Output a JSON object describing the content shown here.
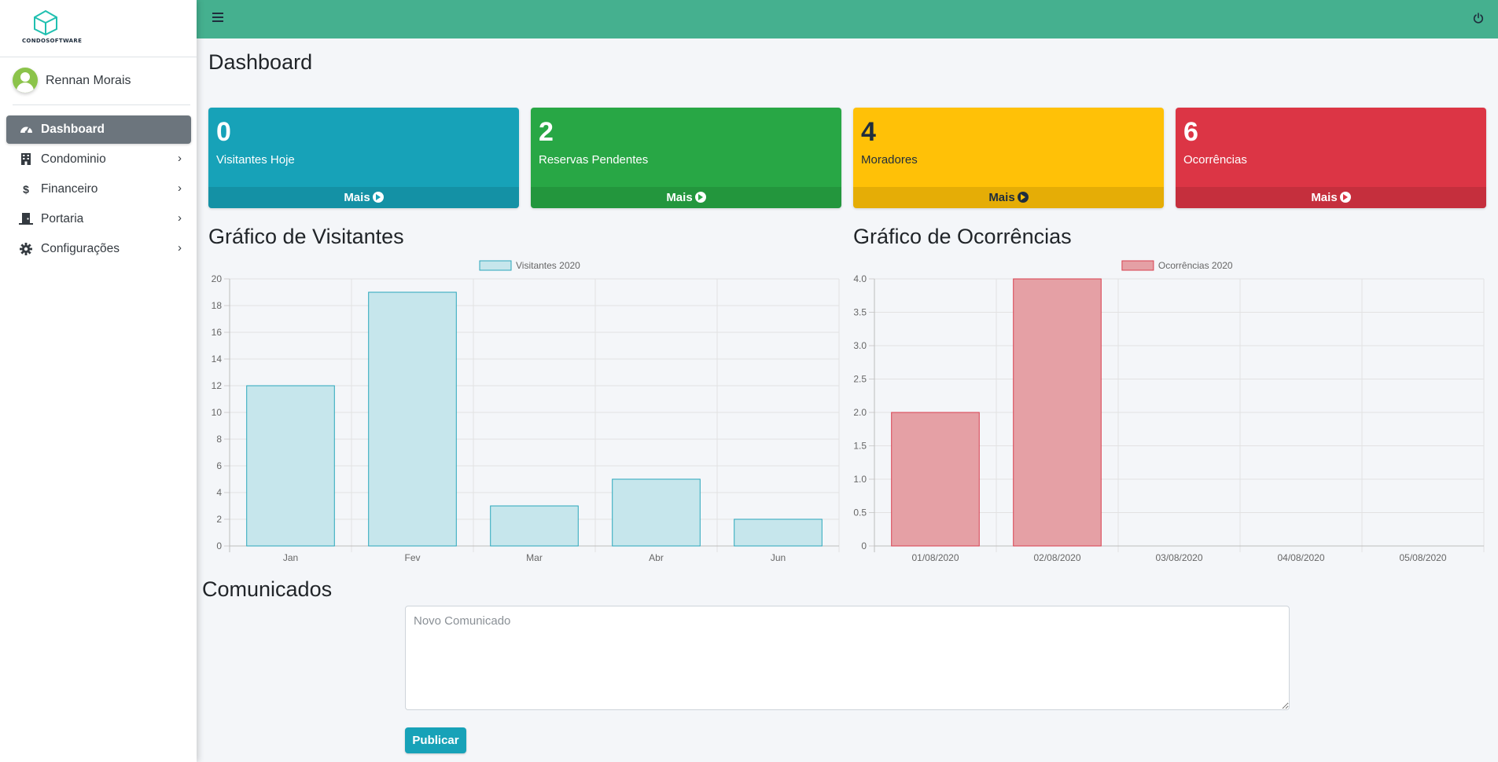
{
  "brand": {
    "name": "CONDOSOFTWARE",
    "logo_icon": "cube-icon",
    "accent": "#20c0b0"
  },
  "user": {
    "name": "Rennan Morais",
    "avatar_icon": "user-avatar-icon"
  },
  "sidebar": {
    "items": [
      {
        "label": "Dashboard",
        "icon": "tachometer-icon",
        "active": true
      },
      {
        "label": "Condominio",
        "icon": "building-icon",
        "has_submenu": true
      },
      {
        "label": "Financeiro",
        "icon": "dollar-icon",
        "has_submenu": true
      },
      {
        "label": "Portaria",
        "icon": "door-icon",
        "has_submenu": true
      },
      {
        "label": "Configurações",
        "icon": "gear-icon",
        "has_submenu": true
      }
    ]
  },
  "topbar": {
    "color": "#45b08f",
    "menu_icon": "hamburger-icon",
    "logout_icon": "power-icon"
  },
  "page": {
    "title": "Dashboard"
  },
  "stats": [
    {
      "value": "0",
      "label": "Visitantes Hoje",
      "more": "Mais",
      "color": "#17a2b8"
    },
    {
      "value": "2",
      "label": "Reservas Pendentes",
      "more": "Mais",
      "color": "#28a745"
    },
    {
      "value": "4",
      "label": "Moradores",
      "more": "Mais",
      "color": "#ffc107"
    },
    {
      "value": "6",
      "label": "Ocorrências",
      "more": "Mais",
      "color": "#dc3545"
    }
  ],
  "charts_section": {
    "visitors_title": "Gráfico de Visitantes",
    "occurrences_title": "Gráfico de Ocorrências"
  },
  "chart_data": [
    {
      "type": "bar",
      "categories": [
        "Jan",
        "Fev",
        "Mar",
        "Abr",
        "Jun"
      ],
      "series": [
        {
          "name": "Visitantes 2020",
          "values": [
            12,
            19,
            3,
            5,
            2
          ]
        }
      ],
      "ylim": [
        0,
        20
      ],
      "yticks": [
        0,
        2,
        4,
        6,
        8,
        10,
        12,
        14,
        16,
        18,
        20
      ],
      "ytick_labels": [
        "0",
        "2",
        "4",
        "6",
        "8",
        "10",
        "12",
        "14",
        "16",
        "18",
        "20"
      ],
      "grid": true,
      "legend": "top-center",
      "fill": "#c6e6ec",
      "stroke": "#2aa7bb"
    },
    {
      "type": "bar",
      "categories": [
        "01/08/2020",
        "02/08/2020",
        "03/08/2020",
        "04/08/2020",
        "05/08/2020"
      ],
      "series": [
        {
          "name": "Ocorrências 2020",
          "values": [
            2,
            4,
            0,
            0,
            0
          ]
        }
      ],
      "ylim": [
        0,
        4
      ],
      "yticks": [
        0,
        0.5,
        1,
        1.5,
        2,
        2.5,
        3,
        3.5,
        4
      ],
      "ytick_labels": [
        "0",
        "0.5",
        "1.0",
        "1.5",
        "2.0",
        "2.5",
        "3.0",
        "3.5",
        "4.0"
      ],
      "grid": true,
      "legend": "top-center",
      "fill": "#e5a0a5",
      "stroke": "#d9404f"
    }
  ],
  "comunicados": {
    "title": "Comunicados",
    "placeholder": "Novo Comunicado",
    "publish_label": "Publicar"
  }
}
